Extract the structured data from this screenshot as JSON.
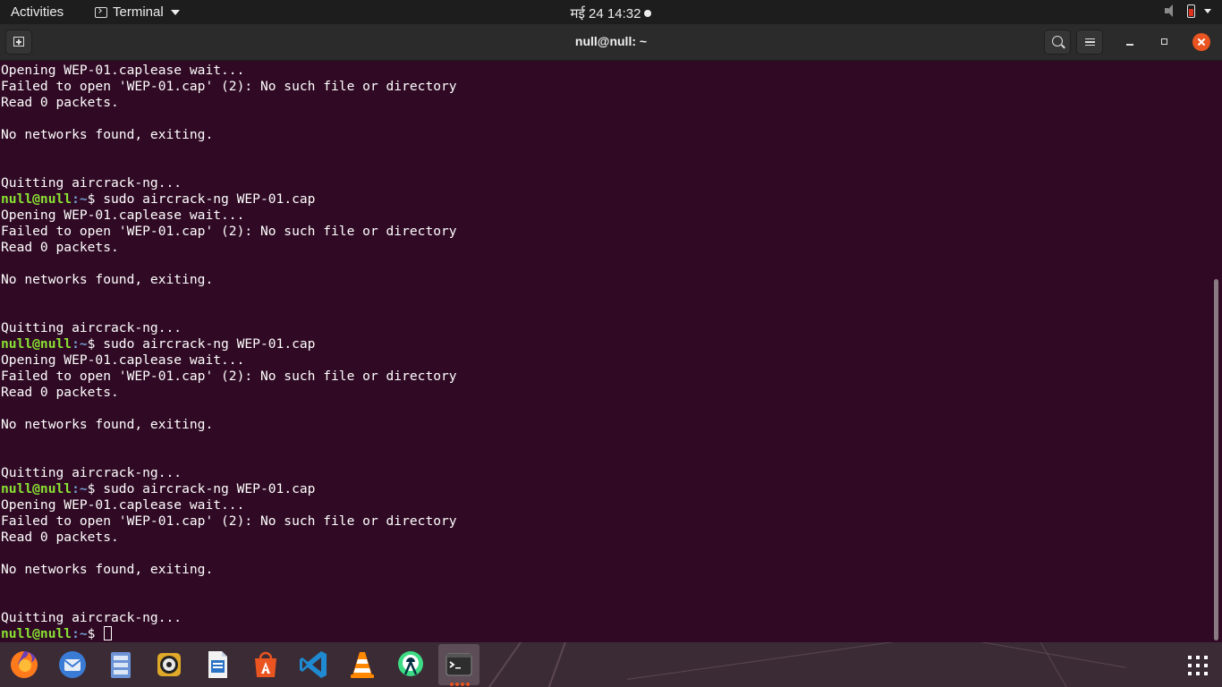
{
  "topbar": {
    "activities": "Activities",
    "app_name": "Terminal",
    "clock_date": "मई 24",
    "clock_time": "14:32"
  },
  "window": {
    "title": "null@null: ~"
  },
  "terminal": {
    "prompt_user": "null@null",
    "prompt_path": ":~",
    "prompt_symbol": "$ ",
    "lines": [
      {
        "text": "Opening WEP-01.caplease wait..."
      },
      {
        "text": "Failed to open 'WEP-01.cap' (2): No such file or directory"
      },
      {
        "text": "Read 0 packets."
      },
      {
        "text": ""
      },
      {
        "text": "No networks found, exiting."
      },
      {
        "text": ""
      },
      {
        "text": ""
      },
      {
        "text": "Quitting aircrack-ng..."
      },
      {
        "prompt": true,
        "text": "sudo aircrack-ng WEP-01.cap"
      },
      {
        "text": "Opening WEP-01.caplease wait..."
      },
      {
        "text": "Failed to open 'WEP-01.cap' (2): No such file or directory"
      },
      {
        "text": "Read 0 packets."
      },
      {
        "text": ""
      },
      {
        "text": "No networks found, exiting."
      },
      {
        "text": ""
      },
      {
        "text": ""
      },
      {
        "text": "Quitting aircrack-ng..."
      },
      {
        "prompt": true,
        "text": "sudo aircrack-ng WEP-01.cap"
      },
      {
        "text": "Opening WEP-01.caplease wait..."
      },
      {
        "text": "Failed to open 'WEP-01.cap' (2): No such file or directory"
      },
      {
        "text": "Read 0 packets."
      },
      {
        "text": ""
      },
      {
        "text": "No networks found, exiting."
      },
      {
        "text": ""
      },
      {
        "text": ""
      },
      {
        "text": "Quitting aircrack-ng..."
      },
      {
        "prompt": true,
        "text": "sudo aircrack-ng WEP-01.cap"
      },
      {
        "text": "Opening WEP-01.caplease wait..."
      },
      {
        "text": "Failed to open 'WEP-01.cap' (2): No such file or directory"
      },
      {
        "text": "Read 0 packets."
      },
      {
        "text": ""
      },
      {
        "text": "No networks found, exiting."
      },
      {
        "text": ""
      },
      {
        "text": ""
      },
      {
        "text": "Quitting aircrack-ng..."
      },
      {
        "prompt": true,
        "text": "",
        "cursor": true
      }
    ]
  },
  "colors": {
    "terminal_bg": "#300a24",
    "prompt_user": "#8ae234",
    "prompt_path": "#729fcf",
    "accent": "#e95420"
  },
  "dock": {
    "apps": [
      {
        "name": "firefox-icon"
      },
      {
        "name": "thunderbird-icon"
      },
      {
        "name": "files-icon"
      },
      {
        "name": "rhythmbox-icon"
      },
      {
        "name": "writer-icon"
      },
      {
        "name": "software-icon"
      },
      {
        "name": "vscode-icon"
      },
      {
        "name": "vlc-icon"
      },
      {
        "name": "android-studio-icon"
      },
      {
        "name": "terminal-icon"
      }
    ]
  }
}
